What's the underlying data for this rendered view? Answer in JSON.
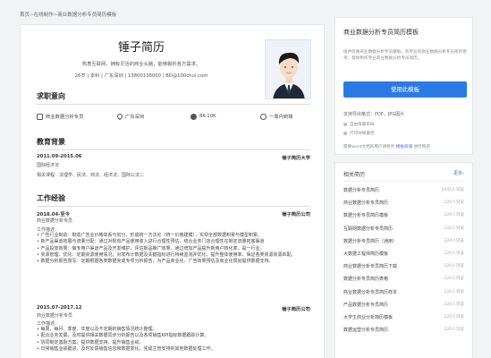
{
  "breadcrumb": [
    "首页",
    "在线制作",
    "商业数据分析专员简历模板"
  ],
  "resume": {
    "name": "锤子简历",
    "intro": "热衷互联网，拥有灵活的商业头脑，能够製析各方需求。",
    "info": "26岁 | 本科 | 广东深圳 | 13800138000 | BD@100chui.com",
    "intent_title": "求职意向",
    "intent": [
      {
        "icon": "briefcase-icon",
        "text": "商业数据分析专员"
      },
      {
        "icon": "location-icon",
        "text": "广东深圳"
      },
      {
        "icon": "money-icon",
        "text": "8K-10K"
      },
      {
        "icon": "clock-icon",
        "text": "一周内到岗"
      }
    ],
    "edu_title": "教育背景",
    "edu": {
      "date": "2011.09-2015.06",
      "school": "锤子简历大学",
      "major": "国际经济法",
      "courses": "相关课程：法理学、民法、商法、经济法、国际公法二"
    },
    "work_title": "工作经验",
    "jobs": [
      {
        "date": "2018.04-至今",
        "company": "锤子简历公司",
        "position": "商业数据分析专员",
        "desc_label": "工作描述：",
        "bullets": [
          "广告行业制造：制造广告业价格体系与划分，形成统一方法论（统一价格建模），实现全部数据积累与模型积累。",
          "新产品渠道拓展与流量分配：通过对现有产品使用收入进行合理性预估，结合业务门店合理性在制定流量拓客渠道",
          "产品投放效果：做专用户渠道产品及开发维护，评估新品推广效果，通过增加产品提升新用户转化率，是一行业。",
          "资源管理、优化：定期资源使用情况，对发布计数据及关键指标进行持续监测并优化，提升整体使用率，保证各类资源资源匹配。",
          "数据分析报告撰写：定期根据各类数据完成专项分析报告，为产品商业化、广告效果预估及商业化规划提供数据支持。"
        ]
      },
      {
        "date": "2015.07-2017.12",
        "company": "锤子简历公司",
        "position": "商业数据分析专员",
        "desc_label": "工作描述：",
        "bullets": [
          "每周、每月、季度、年度以及不定期的销售情况统计整理。",
          "配合业务发展，及时提供相关数据同步分析报告以及各项销售KPI指标数据跟踪计算。",
          "协同制定激励方案，提供数据支持，提升销售业绩。",
          "日常销售业绩跟进、及时反馈销售信息和数据变化，完成主管安排的其他数据处理工作。"
        ]
      }
    ]
  },
  "sidebar": {
    "title": "商业数据分析专员简历模板",
    "desc": "提供优质商业数据分析专员模板，有专业的商业数据分析专员简历参考，帮你制作专业商业数据分析专员简历。",
    "use_button": "使用此模板",
    "support": "支持导出格式：PDF、JPG图片",
    "features": [
      "自由排版布局",
      "打印效果最佳"
    ],
    "share_text": "需要word文档的用户请移步",
    "share_link": "模板商城",
    "share_suffix": "进行购买"
  },
  "related": {
    "title": "相关简历",
    "more": "更多›",
    "items": [
      {
        "label": "数据分析专员简历",
        "count": "4445人浏览"
      },
      {
        "label": "商业数据分析专员简历",
        "count": "220人浏览"
      },
      {
        "label": "数据分析专员简历模板",
        "count": "220人浏览"
      },
      {
        "label": "互联网数据分析专员简历",
        "count": "220人浏览"
      },
      {
        "label": "数据分析专员简历（通用）",
        "count": "220人浏览"
      },
      {
        "label": "大数据工程师简历模板",
        "count": "220人浏览"
      },
      {
        "label": "商业数据分析专员简历下载",
        "count": "220人浏览"
      },
      {
        "label": "数据分析专员简历表格",
        "count": "220人浏览"
      },
      {
        "label": "商业数据分析专员简历样本",
        "count": "220人浏览"
      },
      {
        "label": "产品数据分析专员简历",
        "count": "220人浏览"
      },
      {
        "label": "大学生商业分析简历模板",
        "count": "220人浏览"
      },
      {
        "label": "数据运营分析专员简历",
        "count": "220人浏览"
      }
    ]
  }
}
